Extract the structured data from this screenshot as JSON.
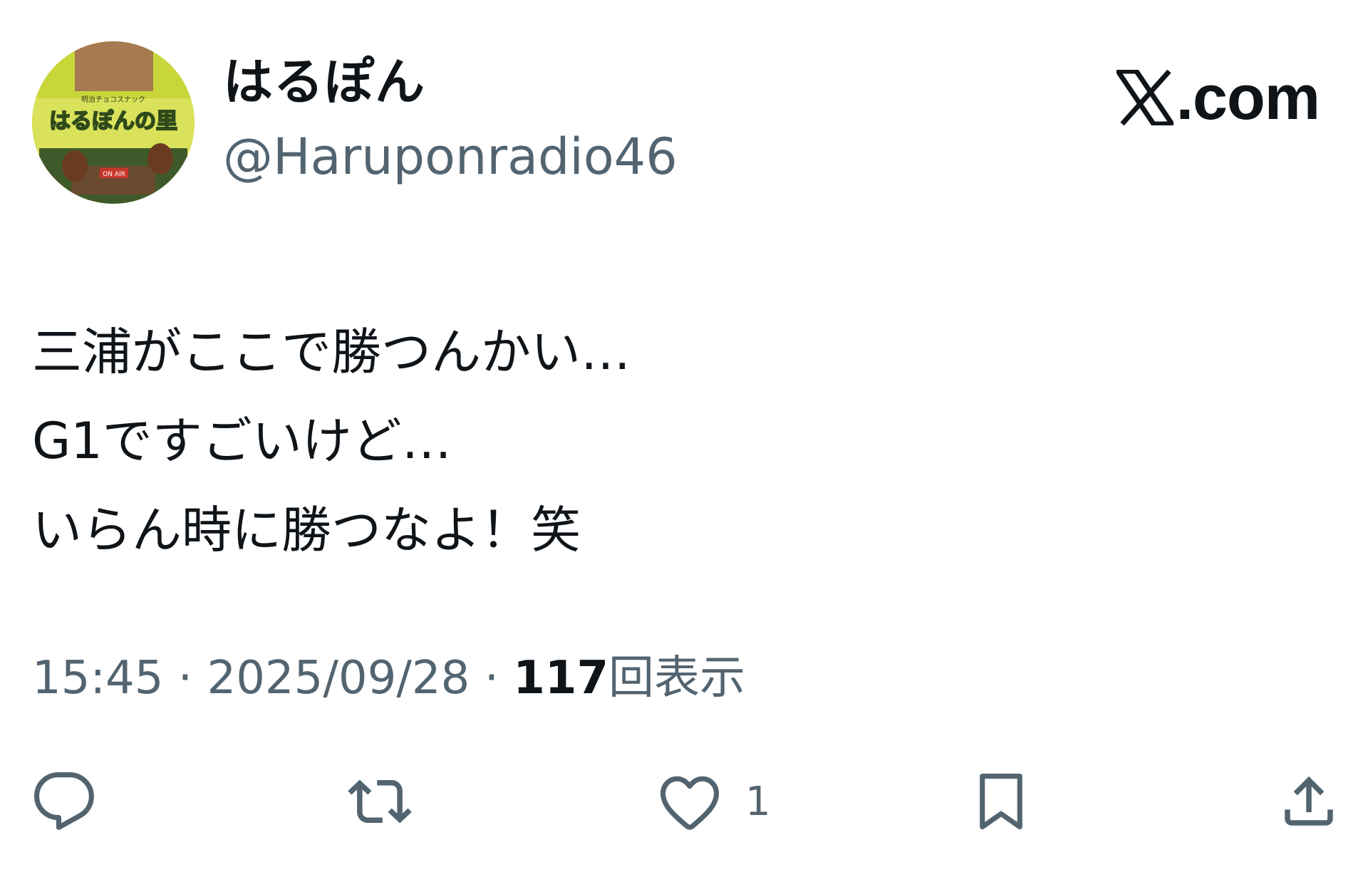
{
  "user": {
    "display_name": "はるぽん",
    "handle": "@Haruponradio46",
    "avatar": {
      "icon": "avatar-image",
      "logo_text": "はるぽんの里",
      "logo_small_text": "明治チョコスナック",
      "sign_text": "ON AIR"
    }
  },
  "brand": {
    "text": ".com",
    "icon": "x-logo-icon"
  },
  "tweet": {
    "lines": [
      "三浦がここで勝つんかい…",
      "G1ですごいけど…",
      "いらん時に勝つなよ！笑"
    ]
  },
  "meta": {
    "time": "15:45",
    "separator": " · ",
    "date": "2025/09/28",
    "views_count": "117",
    "views_label": "回表示"
  },
  "actions": {
    "reply": {
      "icon": "reply-icon"
    },
    "retweet": {
      "icon": "retweet-icon"
    },
    "like": {
      "icon": "heart-icon",
      "count": "1"
    },
    "bookmark": {
      "icon": "bookmark-icon"
    },
    "share": {
      "icon": "share-icon"
    }
  },
  "colors": {
    "text_primary": "#0f1419",
    "text_secondary": "#536471",
    "background": "#ffffff"
  }
}
